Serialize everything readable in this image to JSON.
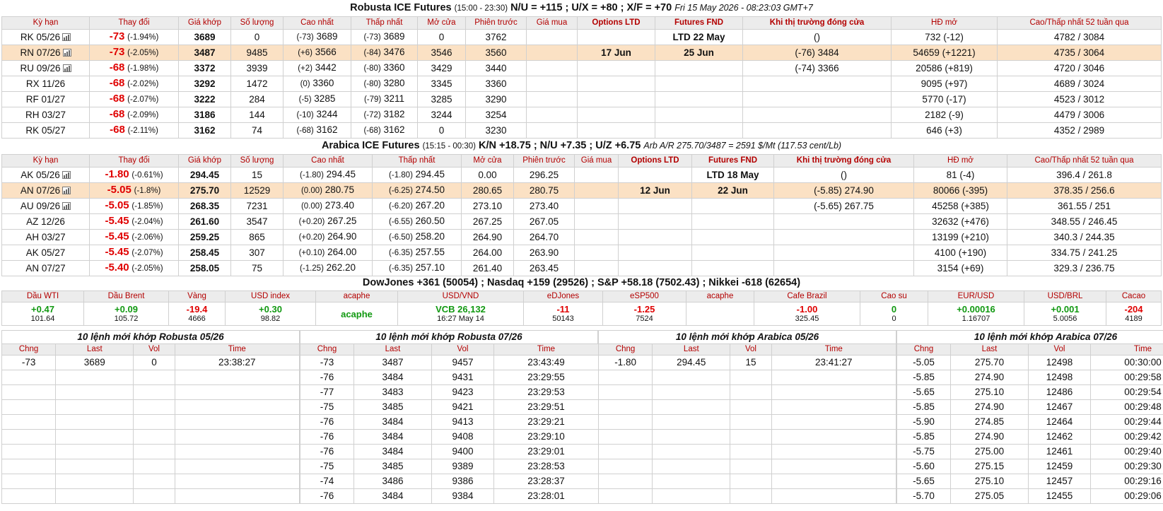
{
  "robusta": {
    "title": "Robusta ICE Futures",
    "hours": "(15:00 - 23:30)",
    "spreads": "N/U = +115 ; U/X = +80 ; X/F = +70",
    "datetime": "Fri 15 May 2026 - 08:23:03 GMT+7",
    "headers": [
      "Kỳ hạn",
      "Thay đổi",
      "Giá khớp",
      "Số lượng",
      "Cao nhất",
      "Thấp nhất",
      "Mở cửa",
      "Phiên trước",
      "Giá mua",
      "Options LTD",
      "Futures FND",
      "Khi thị trường đóng cửa",
      "HĐ mở",
      "Cao/Thấp nhất 52 tuần qua"
    ],
    "rows": [
      {
        "sym": "RK 05/26",
        "chart": true,
        "chg": "-73",
        "pct": "(-1.94%)",
        "last": "3689",
        "vol": "0",
        "hi_chg": "(-73)",
        "hi": "3689",
        "lo_chg": "(-73)",
        "lo": "3689",
        "open": "0",
        "prev": "3762",
        "bid": "",
        "opt": "",
        "fnd": "LTD 22 May",
        "close": "()",
        "oi": "732 (-12)",
        "w52": "4782 / 3084",
        "hl": false
      },
      {
        "sym": "RN 07/26",
        "chart": true,
        "chg": "-73",
        "pct": "(-2.05%)",
        "last": "3487",
        "vol": "9485",
        "hi_chg": "(+6)",
        "hi": "3566",
        "lo_chg": "(-84)",
        "lo": "3476",
        "open": "3546",
        "prev": "3560",
        "bid": "",
        "opt": "17 Jun",
        "fnd": "25 Jun",
        "close": "(-76) 3484",
        "oi": "54659 (+1221)",
        "w52": "4735 / 3064",
        "hl": true
      },
      {
        "sym": "RU 09/26",
        "chart": true,
        "chg": "-68",
        "pct": "(-1.98%)",
        "last": "3372",
        "vol": "3939",
        "hi_chg": "(+2)",
        "hi": "3442",
        "lo_chg": "(-80)",
        "lo": "3360",
        "open": "3429",
        "prev": "3440",
        "bid": "",
        "opt": "",
        "fnd": "",
        "close": "(-74) 3366",
        "oi": "20586 (+819)",
        "w52": "4720 / 3046",
        "hl": false
      },
      {
        "sym": "RX 11/26",
        "chart": false,
        "chg": "-68",
        "pct": "(-2.02%)",
        "last": "3292",
        "vol": "1472",
        "hi_chg": "(0)",
        "hi": "3360",
        "lo_chg": "(-80)",
        "lo": "3280",
        "open": "3345",
        "prev": "3360",
        "bid": "",
        "opt": "",
        "fnd": "",
        "close": "",
        "oi": "9095 (+97)",
        "w52": "4689 / 3024",
        "hl": false
      },
      {
        "sym": "RF 01/27",
        "chart": false,
        "chg": "-68",
        "pct": "(-2.07%)",
        "last": "3222",
        "vol": "284",
        "hi_chg": "(-5)",
        "hi": "3285",
        "lo_chg": "(-79)",
        "lo": "3211",
        "open": "3285",
        "prev": "3290",
        "bid": "",
        "opt": "",
        "fnd": "",
        "close": "",
        "oi": "5770 (-17)",
        "w52": "4523 / 3012",
        "hl": false
      },
      {
        "sym": "RH 03/27",
        "chart": false,
        "chg": "-68",
        "pct": "(-2.09%)",
        "last": "3186",
        "vol": "144",
        "hi_chg": "(-10)",
        "hi": "3244",
        "lo_chg": "(-72)",
        "lo": "3182",
        "open": "3244",
        "prev": "3254",
        "bid": "",
        "opt": "",
        "fnd": "",
        "close": "",
        "oi": "2182 (-9)",
        "w52": "4479 / 3006",
        "hl": false
      },
      {
        "sym": "RK 05/27",
        "chart": false,
        "chg": "-68",
        "pct": "(-2.11%)",
        "last": "3162",
        "vol": "74",
        "hi_chg": "(-68)",
        "hi": "3162",
        "lo_chg": "(-68)",
        "lo": "3162",
        "open": "0",
        "prev": "3230",
        "bid": "",
        "opt": "",
        "fnd": "",
        "close": "",
        "oi": "646 (+3)",
        "w52": "4352 / 2989",
        "hl": false
      }
    ]
  },
  "arabica": {
    "title": "Arabica ICE Futures",
    "hours": "(15:15 - 00:30)",
    "spreads": "K/N +18.75 ; N/U +7.35 ; U/Z +6.75",
    "arb": "Arb A/R 275.70/3487 = 2591 $/Mt (117.53 cent/Lb)",
    "headers": [
      "Kỳ hạn",
      "Thay đổi",
      "Giá khớp",
      "Số lượng",
      "Cao nhất",
      "Thấp nhất",
      "Mở cửa",
      "Phiên trước",
      "Giá mua",
      "Options LTD",
      "Futures FND",
      "Khi thị trường đóng cửa",
      "HĐ mở",
      "Cao/Thấp nhất 52 tuần qua"
    ],
    "rows": [
      {
        "sym": "AK 05/26",
        "chart": true,
        "chg": "-1.80",
        "pct": "(-0.61%)",
        "last": "294.45",
        "vol": "15",
        "hi_chg": "(-1.80)",
        "hi": "294.45",
        "lo_chg": "(-1.80)",
        "lo": "294.45",
        "open": "0.00",
        "prev": "296.25",
        "bid": "",
        "opt": "",
        "fnd": "LTD 18 May",
        "close": "()",
        "oi": "81 (-4)",
        "w52": "396.4 / 261.8",
        "hl": false
      },
      {
        "sym": "AN 07/26",
        "chart": true,
        "chg": "-5.05",
        "pct": "(-1.8%)",
        "last": "275.70",
        "vol": "12529",
        "hi_chg": "(0.00)",
        "hi": "280.75",
        "lo_chg": "(-6.25)",
        "lo": "274.50",
        "open": "280.65",
        "prev": "280.75",
        "bid": "",
        "opt": "12 Jun",
        "fnd": "22 Jun",
        "close": "(-5.85) 274.90",
        "oi": "80066 (-395)",
        "w52": "378.35 / 256.6",
        "hl": true
      },
      {
        "sym": "AU 09/26",
        "chart": true,
        "chg": "-5.05",
        "pct": "(-1.85%)",
        "last": "268.35",
        "vol": "7231",
        "hi_chg": "(0.00)",
        "hi": "273.40",
        "lo_chg": "(-6.20)",
        "lo": "267.20",
        "open": "273.10",
        "prev": "273.40",
        "bid": "",
        "opt": "",
        "fnd": "",
        "close": "(-5.65) 267.75",
        "oi": "45258 (+385)",
        "w52": "361.55 / 251",
        "hl": false
      },
      {
        "sym": "AZ 12/26",
        "chart": false,
        "chg": "-5.45",
        "pct": "(-2.04%)",
        "last": "261.60",
        "vol": "3547",
        "hi_chg": "(+0.20)",
        "hi": "267.25",
        "lo_chg": "(-6.55)",
        "lo": "260.50",
        "open": "267.25",
        "prev": "267.05",
        "bid": "",
        "opt": "",
        "fnd": "",
        "close": "",
        "oi": "32632 (+476)",
        "w52": "348.55 / 246.45",
        "hl": false
      },
      {
        "sym": "AH 03/27",
        "chart": false,
        "chg": "-5.45",
        "pct": "(-2.06%)",
        "last": "259.25",
        "vol": "865",
        "hi_chg": "(+0.20)",
        "hi": "264.90",
        "lo_chg": "(-6.50)",
        "lo": "258.20",
        "open": "264.90",
        "prev": "264.70",
        "bid": "",
        "opt": "",
        "fnd": "",
        "close": "",
        "oi": "13199 (+210)",
        "w52": "340.3 / 244.35",
        "hl": false
      },
      {
        "sym": "AK 05/27",
        "chart": false,
        "chg": "-5.45",
        "pct": "(-2.07%)",
        "last": "258.45",
        "vol": "307",
        "hi_chg": "(+0.10)",
        "hi": "264.00",
        "lo_chg": "(-6.35)",
        "lo": "257.55",
        "open": "264.00",
        "prev": "263.90",
        "bid": "",
        "opt": "",
        "fnd": "",
        "close": "",
        "oi": "4100 (+190)",
        "w52": "334.75 / 241.25",
        "hl": false
      },
      {
        "sym": "AN 07/27",
        "chart": false,
        "chg": "-5.40",
        "pct": "(-2.05%)",
        "last": "258.05",
        "vol": "75",
        "hi_chg": "(-1.25)",
        "hi": "262.20",
        "lo_chg": "(-6.35)",
        "lo": "257.10",
        "open": "261.40",
        "prev": "263.45",
        "bid": "",
        "opt": "",
        "fnd": "",
        "close": "",
        "oi": "3154 (+69)",
        "w52": "329.3 / 236.75",
        "hl": false
      }
    ]
  },
  "markets_title": "DowJones +361 (50054) ; Nasdaq +159 (29526) ; S&P +58.18 (7502.43) ; Nikkei -618 (62654)",
  "indices": [
    {
      "name": "Dầu WTI",
      "v1": "+0.47",
      "v2": "101.64",
      "dir": "pos"
    },
    {
      "name": "Dầu Brent",
      "v1": "+0.09",
      "v2": "105.72",
      "dir": "pos"
    },
    {
      "name": "Vàng",
      "v1": "-19.4",
      "v2": "4666",
      "dir": "neg"
    },
    {
      "name": "USD index",
      "v1": "+0.30",
      "v2": "98.82",
      "dir": "pos"
    },
    {
      "name": "acaphe",
      "v1": "acaphe",
      "v2": "",
      "dir": "pos"
    },
    {
      "name": "USD/VND",
      "v1": "VCB 26,132",
      "v2": "16:27 May 14",
      "dir": "pos"
    },
    {
      "name": "eDJones",
      "v1": "-11",
      "v2": "50143",
      "dir": "neg"
    },
    {
      "name": "eSP500",
      "v1": "-1.25",
      "v2": "7524",
      "dir": "neg"
    },
    {
      "name": "acaphe",
      "v1": "",
      "v2": "",
      "dir": "pos"
    },
    {
      "name": "Cafe Brazil",
      "v1": "-1.00",
      "v2": "325.45",
      "dir": "neg"
    },
    {
      "name": "Cao su",
      "v1": "0",
      "v2": "0",
      "dir": "pos"
    },
    {
      "name": "EUR/USD",
      "v1": "+0.00016",
      "v2": "1.16707",
      "dir": "pos"
    },
    {
      "name": "USD/BRL",
      "v1": "+0.001",
      "v2": "5.0056",
      "dir": "pos"
    },
    {
      "name": "Cacao",
      "v1": "-204",
      "v2": "4189",
      "dir": "neg"
    }
  ],
  "trades": [
    {
      "title": "10 lệnh mới khớp Robusta 05/26",
      "headers": [
        "Chng",
        "Last",
        "Vol",
        "Time"
      ],
      "rows": [
        [
          "-73",
          "3689",
          "0",
          "23:38:27"
        ]
      ]
    },
    {
      "title": "10 lệnh mới khớp Robusta 07/26",
      "headers": [
        "Chng",
        "Last",
        "Vol",
        "Time"
      ],
      "rows": [
        [
          "-73",
          "3487",
          "9457",
          "23:43:49"
        ],
        [
          "-76",
          "3484",
          "9431",
          "23:29:55"
        ],
        [
          "-77",
          "3483",
          "9423",
          "23:29:53"
        ],
        [
          "-75",
          "3485",
          "9421",
          "23:29:51"
        ],
        [
          "-76",
          "3484",
          "9413",
          "23:29:21"
        ],
        [
          "-76",
          "3484",
          "9408",
          "23:29:10"
        ],
        [
          "-76",
          "3484",
          "9400",
          "23:29:01"
        ],
        [
          "-75",
          "3485",
          "9389",
          "23:28:53"
        ],
        [
          "-74",
          "3486",
          "9386",
          "23:28:37"
        ],
        [
          "-76",
          "3484",
          "9384",
          "23:28:01"
        ]
      ]
    },
    {
      "title": "10 lệnh mới khớp Arabica 05/26",
      "headers": [
        "Chng",
        "Last",
        "Vol",
        "Time"
      ],
      "rows": [
        [
          "-1.80",
          "294.45",
          "15",
          "23:41:27"
        ]
      ]
    },
    {
      "title": "10 lệnh mới khớp Arabica 07/26",
      "headers": [
        "Chng",
        "Last",
        "Vol",
        "Time"
      ],
      "rows": [
        [
          "-5.05",
          "275.70",
          "12498",
          "00:30:00"
        ],
        [
          "-5.85",
          "274.90",
          "12498",
          "00:29:58"
        ],
        [
          "-5.65",
          "275.10",
          "12486",
          "00:29:54"
        ],
        [
          "-5.85",
          "274.90",
          "12467",
          "00:29:48"
        ],
        [
          "-5.90",
          "274.85",
          "12464",
          "00:29:44"
        ],
        [
          "-5.85",
          "274.90",
          "12462",
          "00:29:42"
        ],
        [
          "-5.75",
          "275.00",
          "12461",
          "00:29:40"
        ],
        [
          "-5.60",
          "275.15",
          "12459",
          "00:29:30"
        ],
        [
          "-5.65",
          "275.10",
          "12457",
          "00:29:16"
        ],
        [
          "-5.70",
          "275.05",
          "12455",
          "00:29:06"
        ]
      ]
    }
  ]
}
